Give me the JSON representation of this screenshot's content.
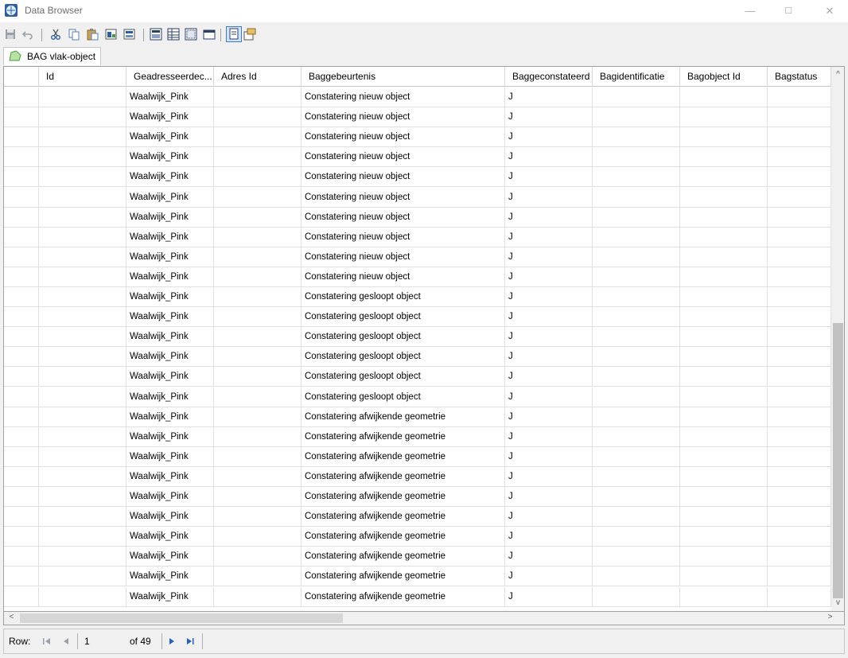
{
  "window": {
    "title": "Data Browser",
    "minimize": "—",
    "maximize": "☐",
    "close": "✕"
  },
  "toolbar": {
    "icons": [
      "save-icon",
      "undo-icon",
      "cut-icon",
      "copy-icon",
      "paste-icon",
      "find-icon",
      "export-icon",
      "select-all-icon",
      "table-icon",
      "select-rows-icon",
      "column-icon",
      "page-icon",
      "properties-icon"
    ]
  },
  "tab": {
    "label": "BAG vlak-object",
    "color": "#b7e4a3"
  },
  "table": {
    "columns": [
      "",
      "Id",
      "Geadresseerdec...",
      "Adres Id",
      "Baggebeurtenis",
      "Baggeconstateerd",
      "Bagidentificatie",
      "Bagobject Id",
      "Bagstatus"
    ],
    "rows": [
      [
        "",
        "",
        "Waalwijk_Pink",
        "",
        "Constatering nieuw object",
        "J",
        "",
        "",
        ""
      ],
      [
        "",
        "",
        "Waalwijk_Pink",
        "",
        "Constatering nieuw object",
        "J",
        "",
        "",
        ""
      ],
      [
        "",
        "",
        "Waalwijk_Pink",
        "",
        "Constatering nieuw object",
        "J",
        "",
        "",
        ""
      ],
      [
        "",
        "",
        "Waalwijk_Pink",
        "",
        "Constatering nieuw object",
        "J",
        "",
        "",
        ""
      ],
      [
        "",
        "",
        "Waalwijk_Pink",
        "",
        "Constatering nieuw object",
        "J",
        "",
        "",
        ""
      ],
      [
        "",
        "",
        "Waalwijk_Pink",
        "",
        "Constatering nieuw object",
        "J",
        "",
        "",
        ""
      ],
      [
        "",
        "",
        "Waalwijk_Pink",
        "",
        "Constatering nieuw object",
        "J",
        "",
        "",
        ""
      ],
      [
        "",
        "",
        "Waalwijk_Pink",
        "",
        "Constatering nieuw object",
        "J",
        "",
        "",
        ""
      ],
      [
        "",
        "",
        "Waalwijk_Pink",
        "",
        "Constatering nieuw object",
        "J",
        "",
        "",
        ""
      ],
      [
        "",
        "",
        "Waalwijk_Pink",
        "",
        "Constatering nieuw object",
        "J",
        "",
        "",
        ""
      ],
      [
        "",
        "",
        "Waalwijk_Pink",
        "",
        "Constatering gesloopt object",
        "J",
        "",
        "",
        ""
      ],
      [
        "",
        "",
        "Waalwijk_Pink",
        "",
        "Constatering gesloopt object",
        "J",
        "",
        "",
        ""
      ],
      [
        "",
        "",
        "Waalwijk_Pink",
        "",
        "Constatering gesloopt object",
        "J",
        "",
        "",
        ""
      ],
      [
        "",
        "",
        "Waalwijk_Pink",
        "",
        "Constatering gesloopt object",
        "J",
        "",
        "",
        ""
      ],
      [
        "",
        "",
        "Waalwijk_Pink",
        "",
        "Constatering gesloopt object",
        "J",
        "",
        "",
        ""
      ],
      [
        "",
        "",
        "Waalwijk_Pink",
        "",
        "Constatering gesloopt object",
        "J",
        "",
        "",
        ""
      ],
      [
        "",
        "",
        "Waalwijk_Pink",
        "",
        "Constatering afwijkende geometrie",
        "J",
        "",
        "",
        ""
      ],
      [
        "",
        "",
        "Waalwijk_Pink",
        "",
        "Constatering afwijkende geometrie",
        "J",
        "",
        "",
        ""
      ],
      [
        "",
        "",
        "Waalwijk_Pink",
        "",
        "Constatering afwijkende geometrie",
        "J",
        "",
        "",
        ""
      ],
      [
        "",
        "",
        "Waalwijk_Pink",
        "",
        "Constatering afwijkende geometrie",
        "J",
        "",
        "",
        ""
      ],
      [
        "",
        "",
        "Waalwijk_Pink",
        "",
        "Constatering afwijkende geometrie",
        "J",
        "",
        "",
        ""
      ],
      [
        "",
        "",
        "Waalwijk_Pink",
        "",
        "Constatering afwijkende geometrie",
        "J",
        "",
        "",
        ""
      ],
      [
        "",
        "",
        "Waalwijk_Pink",
        "",
        "Constatering afwijkende geometrie",
        "J",
        "",
        "",
        ""
      ],
      [
        "",
        "",
        "Waalwijk_Pink",
        "",
        "Constatering afwijkende geometrie",
        "J",
        "",
        "",
        ""
      ],
      [
        "",
        "",
        "Waalwijk_Pink",
        "",
        "Constatering afwijkende geometrie",
        "J",
        "",
        "",
        ""
      ],
      [
        "",
        "",
        "Waalwijk_Pink",
        "",
        "Constatering afwijkende geometrie",
        "J",
        "",
        "",
        ""
      ]
    ]
  },
  "scrollbars": {
    "up": "^",
    "down": "v",
    "left": "<",
    "right": ">"
  },
  "navigator": {
    "row_label": "Row:",
    "current": "1",
    "total": "of 49"
  },
  "colors": {
    "accent": "#1f5fd0",
    "grid_line": "#e0e0e0",
    "thumb": "#c2c2c2"
  }
}
